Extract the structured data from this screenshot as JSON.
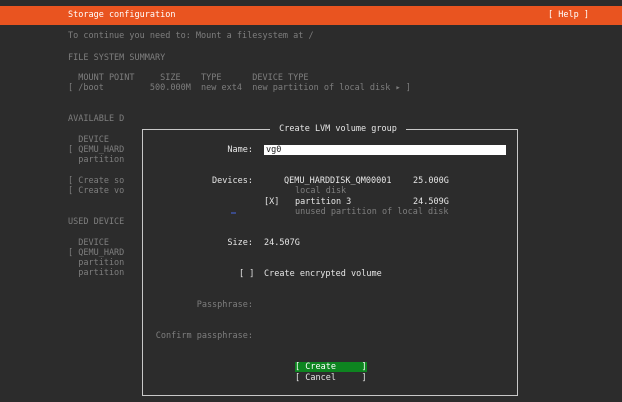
{
  "header": {
    "title": "Storage configuration",
    "help_label": "[ Help ]"
  },
  "background": {
    "instruction": "To continue you need to: Mount a filesystem at /",
    "fs_summary_heading": "FILE SYSTEM SUMMARY",
    "fs_columns": "  MOUNT POINT     SIZE    TYPE      DEVICE TYPE",
    "fs_row": "[ /boot         500.000M  new ext4  new partition of local disk ▸ ]",
    "available_heading": "AVAILABLE D",
    "available_lines": [
      "  DEVICE",
      "[ QEMU_HARD",
      "  partition",
      "",
      "[ Create so",
      "[ Create vo"
    ],
    "used_heading": "USED DEVICE",
    "used_lines": [
      "  DEVICE",
      "[ QEMU_HARD",
      "  partition",
      "  partition"
    ]
  },
  "dialog": {
    "title": " Create LVM volume group ",
    "name_label": "Name:",
    "name_value": "vg0",
    "devices_label": "Devices:",
    "devices": [
      {
        "checkbox": "",
        "name": "QEMU_HARDDISK_QM00001",
        "size": "25.000G",
        "desc": "local disk"
      },
      {
        "checkbox": "[X]",
        "name": "partition 3",
        "size": "24.509G",
        "desc": "unused partition of local disk"
      }
    ],
    "size_label": "Size:",
    "size_value": "24.507G",
    "encrypt_checkbox": "[ ]",
    "encrypt_label": "Create encrypted volume",
    "passphrase_label": "Passphrase:",
    "confirm_passphrase_label": "Confirm passphrase:",
    "create_label": "[ Create     ]",
    "cancel_label": "[ Cancel     ]"
  },
  "colors": {
    "header_bg": "#e95420",
    "background": "#2c2c2c",
    "create_button_bg": "#0e8420"
  }
}
